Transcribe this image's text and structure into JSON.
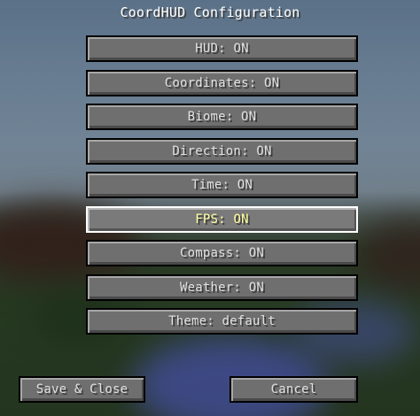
{
  "screen": {
    "title": "CoordHUD Configuration"
  },
  "options": [
    {
      "label": "HUD: ON",
      "name": "hud-toggle-button"
    },
    {
      "label": "Coordinates: ON",
      "name": "coordinates-toggle-button"
    },
    {
      "label": "Biome: ON",
      "name": "biome-toggle-button"
    },
    {
      "label": "Direction: ON",
      "name": "direction-toggle-button"
    },
    {
      "label": "Time: ON",
      "name": "time-toggle-button"
    },
    {
      "label": "FPS: ON",
      "name": "fps-toggle-button"
    },
    {
      "label": "Compass: ON",
      "name": "compass-toggle-button"
    },
    {
      "label": "Weather: ON",
      "name": "weather-toggle-button"
    },
    {
      "label": "Theme: default",
      "name": "theme-cycle-button"
    }
  ],
  "footer": {
    "save_label": "Save & Close",
    "cancel_label": "Cancel"
  }
}
